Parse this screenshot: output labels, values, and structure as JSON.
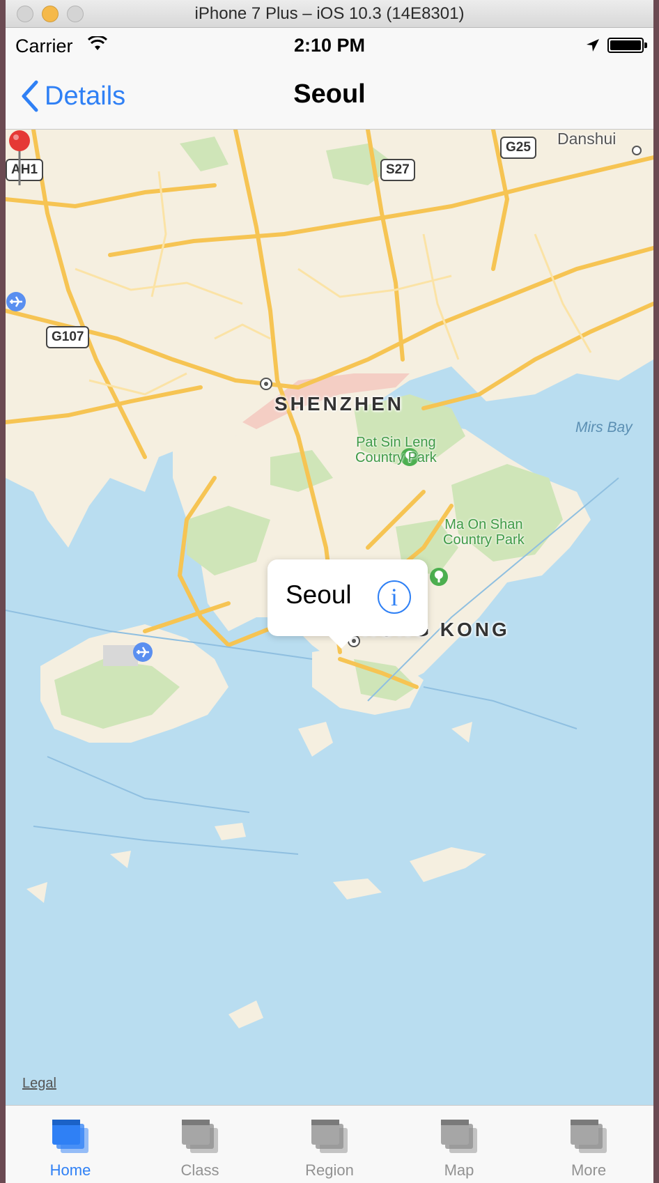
{
  "window": {
    "title": "iPhone 7 Plus – iOS 10.3 (14E8301)"
  },
  "status_bar": {
    "carrier": "Carrier",
    "time": "2:10 PM"
  },
  "nav_bar": {
    "back_label": "Details",
    "title": "Seoul"
  },
  "map": {
    "labels": {
      "shenzhen": "SHENZHEN",
      "hong_kong": "HONG KONG",
      "danshui": "Danshui",
      "mirs_bay": "Mirs Bay",
      "pat_sin_leng": "Pat Sin Leng\nCountry Park",
      "ma_on_shan": "Ma On Shan\nCountry Park"
    },
    "shields": {
      "g25": "G25",
      "s27": "S27",
      "ah1": "AH1",
      "g107": "G107"
    },
    "legal": "Legal",
    "callout": {
      "title": "Seoul",
      "info_glyph": "i"
    }
  },
  "tab_bar": {
    "tabs": [
      {
        "label": "Home",
        "active": true
      },
      {
        "label": "Class",
        "active": false
      },
      {
        "label": "Region",
        "active": false
      },
      {
        "label": "Map",
        "active": false
      },
      {
        "label": "More",
        "active": false
      }
    ]
  },
  "colors": {
    "accent": "#2f80f5",
    "inactive_tab": "#929292",
    "water": "#b9ddf0",
    "land": "#f5efe0",
    "park": "#cfe5b8",
    "road": "#f6c453",
    "pin": "#e53935"
  }
}
